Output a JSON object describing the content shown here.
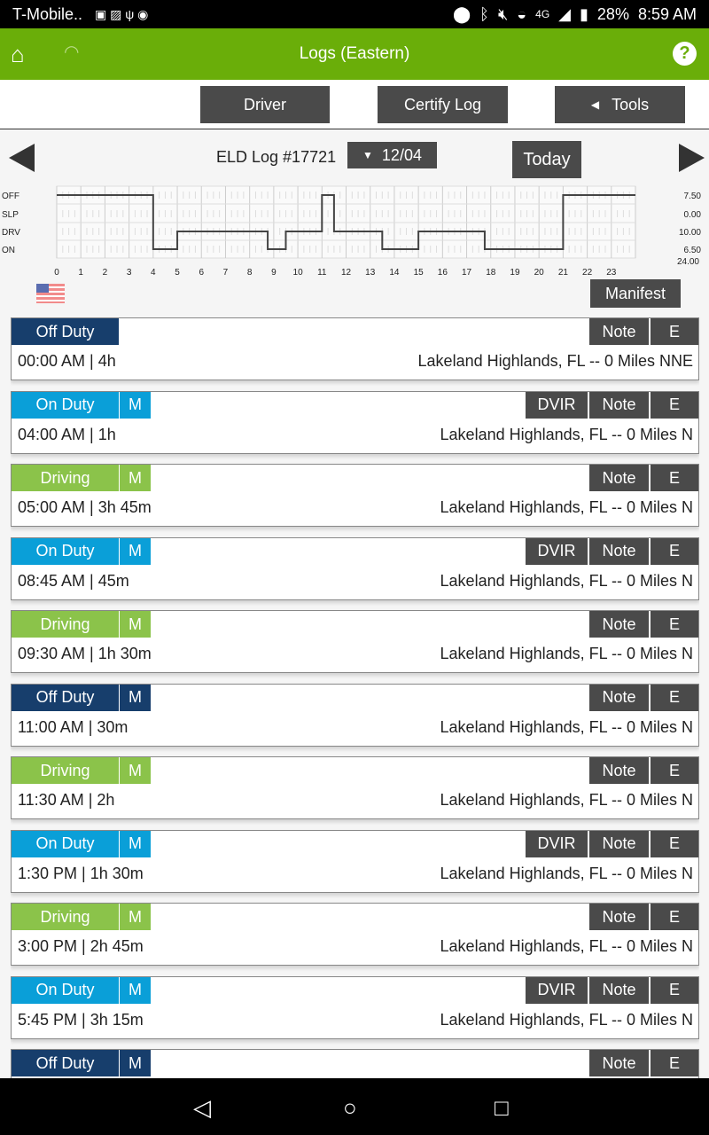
{
  "status_bar": {
    "carrier": "T-Mobile..",
    "battery": "28%",
    "time": "8:59 AM",
    "network": "4G"
  },
  "app_bar": {
    "title": "Logs (Eastern)"
  },
  "toolbar": {
    "driver": "Driver",
    "certify": "Certify Log",
    "tools": "Tools"
  },
  "log": {
    "title": "ELD Log #17721",
    "date": "12/04",
    "today": "Today",
    "manifest": "Manifest"
  },
  "chart_data": {
    "type": "line",
    "title": "",
    "status_labels": [
      "OFF",
      "SLP",
      "DRV",
      "ON"
    ],
    "x_ticks": [
      "0",
      "1",
      "2",
      "3",
      "4",
      "5",
      "6",
      "7",
      "8",
      "9",
      "10",
      "11",
      "12",
      "13",
      "14",
      "15",
      "16",
      "17",
      "18",
      "19",
      "20",
      "21",
      "22",
      "23"
    ],
    "xlim": [
      0,
      24
    ],
    "segments": [
      {
        "status": "OFF",
        "start": 0,
        "end": 4
      },
      {
        "status": "ON",
        "start": 4,
        "end": 5
      },
      {
        "status": "DRV",
        "start": 5,
        "end": 8.75
      },
      {
        "status": "ON",
        "start": 8.75,
        "end": 9.5
      },
      {
        "status": "DRV",
        "start": 9.5,
        "end": 11
      },
      {
        "status": "OFF",
        "start": 11,
        "end": 11.5
      },
      {
        "status": "DRV",
        "start": 11.5,
        "end": 13.5
      },
      {
        "status": "ON",
        "start": 13.5,
        "end": 15
      },
      {
        "status": "DRV",
        "start": 15,
        "end": 17.75
      },
      {
        "status": "ON",
        "start": 17.75,
        "end": 21
      },
      {
        "status": "OFF",
        "start": 21,
        "end": 24
      }
    ],
    "totals": [
      "7.50",
      "0.00",
      "10.00",
      "6.50"
    ],
    "grand_total": "24.00"
  },
  "colors": {
    "Off Duty": "#173e6c",
    "On Duty": "#0a9fd8",
    "Driving": "#8bc34a",
    "accent": "#6aae09"
  },
  "labels": {
    "m": "M",
    "dvir": "DVIR",
    "note": "Note",
    "e": "E"
  },
  "entries": [
    {
      "status": "Off Duty",
      "m": false,
      "dvir": false,
      "time": "00:00 AM | 4h",
      "location": "Lakeland Highlands, FL -- 0 Miles NNE"
    },
    {
      "status": "On Duty",
      "m": true,
      "dvir": true,
      "time": "04:00 AM | 1h",
      "location": "Lakeland Highlands, FL -- 0 Miles N"
    },
    {
      "status": "Driving",
      "m": true,
      "dvir": false,
      "time": "05:00 AM | 3h 45m",
      "location": "Lakeland Highlands, FL -- 0 Miles N"
    },
    {
      "status": "On Duty",
      "m": true,
      "dvir": true,
      "time": "08:45 AM | 45m",
      "location": "Lakeland Highlands, FL -- 0 Miles N"
    },
    {
      "status": "Driving",
      "m": true,
      "dvir": false,
      "time": "09:30 AM | 1h 30m",
      "location": "Lakeland Highlands, FL -- 0 Miles N"
    },
    {
      "status": "Off Duty",
      "m": true,
      "dvir": false,
      "time": "11:00 AM | 30m",
      "location": "Lakeland Highlands, FL -- 0 Miles N"
    },
    {
      "status": "Driving",
      "m": true,
      "dvir": false,
      "time": "11:30 AM | 2h",
      "location": "Lakeland Highlands, FL -- 0 Miles N"
    },
    {
      "status": "On Duty",
      "m": true,
      "dvir": true,
      "time": "1:30 PM | 1h 30m",
      "location": "Lakeland Highlands, FL -- 0 Miles N"
    },
    {
      "status": "Driving",
      "m": true,
      "dvir": false,
      "time": "3:00 PM | 2h 45m",
      "location": "Lakeland Highlands, FL -- 0 Miles N"
    },
    {
      "status": "On Duty",
      "m": true,
      "dvir": true,
      "time": "5:45 PM | 3h 15m",
      "location": "Lakeland Highlands, FL -- 0 Miles N"
    },
    {
      "status": "Off Duty",
      "m": true,
      "dvir": false,
      "time": "",
      "location": ""
    }
  ]
}
